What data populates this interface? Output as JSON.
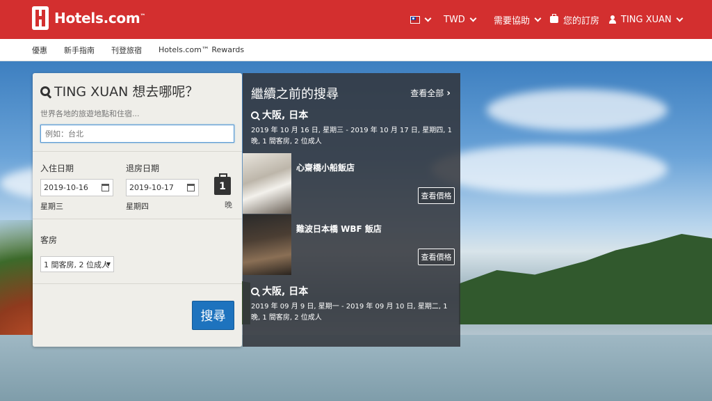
{
  "header": {
    "logo_text": "Hotels.com",
    "logo_tm": "™",
    "currency": "TWD",
    "help": "需要協助",
    "bookings": "您的訂房",
    "user": "TING XUAN"
  },
  "subnav": {
    "items": [
      "優惠",
      "新手指南",
      "刊登旅宿",
      "Hotels.com™ Rewards"
    ]
  },
  "search": {
    "title": "TING XUAN 想去哪呢？",
    "subtitle": "世界各地的旅遊地點和住宿...",
    "destination_placeholder": "例如：台北",
    "checkin_label": "入住日期",
    "checkout_label": "退房日期",
    "checkin_value": "2019-10-16",
    "checkout_value": "2019-10-17",
    "checkin_dow": "星期三",
    "checkout_dow": "星期四",
    "nights": "1",
    "nights_label": "晚",
    "rooms_label": "客房",
    "rooms_value": "1 間客房, 2 位成人",
    "search_button": "搜尋"
  },
  "recent": {
    "title": "繼續之前的搜尋",
    "view_all": "查看全部",
    "searches": [
      {
        "city": "大阪, 日本",
        "dates": "2019 年 10 月 16 日, 星期三 - 2019 年 10 月 17 日, 星期四, 1 晚, 1 間客房, 2 位成人",
        "hotels": [
          {
            "name": "心齋橋小船飯店",
            "button": "查看價格"
          },
          {
            "name": "難波日本橋 WBF 飯店",
            "button": "查看價格"
          }
        ]
      },
      {
        "city": "大阪, 日本",
        "dates": "2019 年 09 月 9 日, 星期一 - 2019 年 09 月 10 日, 星期二, 1 晚, 1 間客房, 2 位成人"
      }
    ]
  },
  "colors": {
    "brand_red": "#d32f2f",
    "search_blue": "#1e73be"
  }
}
